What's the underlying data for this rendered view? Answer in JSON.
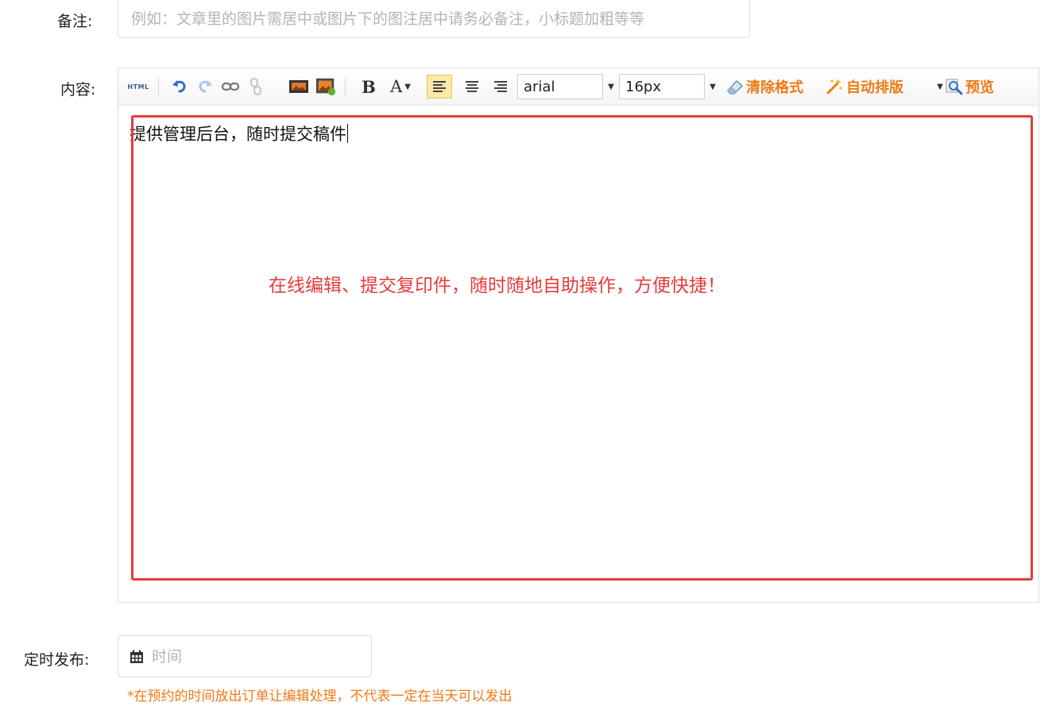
{
  "remark": {
    "label": "备注:",
    "placeholder": "例如：文章里的图片需居中或图片下的图注居中请务必备注，小标题加粗等等"
  },
  "content": {
    "label": "内容:",
    "toolbar": {
      "html_label": "HTML",
      "bold_label": "B",
      "font_color_label": "A",
      "font_family": "arial",
      "font_size": "16px",
      "clear_format_label": "清除格式",
      "auto_layout_label": "自动排版",
      "preview_label": "预览"
    },
    "editor_text": "提供管理后台，随时提交稿件",
    "annotation_text": "在线编辑、提交复印件，随时随地自助操作，方便快捷！"
  },
  "schedule": {
    "label": "定时发布:",
    "placeholder": "时间",
    "hint": "*在预约的时间放出订单让编辑处理，不代表一定在当天可以发出"
  },
  "colors": {
    "accent_orange": "#f07a16",
    "annotation_red": "#e63b3b",
    "active_align_bg": "#fbe9a6"
  },
  "icons": [
    "undo-icon",
    "redo-icon",
    "link-icon",
    "unlink-icon",
    "image-icon",
    "insert-image-icon",
    "align-left-icon",
    "align-center-icon",
    "align-right-icon",
    "eraser-icon",
    "magic-wand-icon",
    "magnifier-icon",
    "calendar-icon"
  ]
}
